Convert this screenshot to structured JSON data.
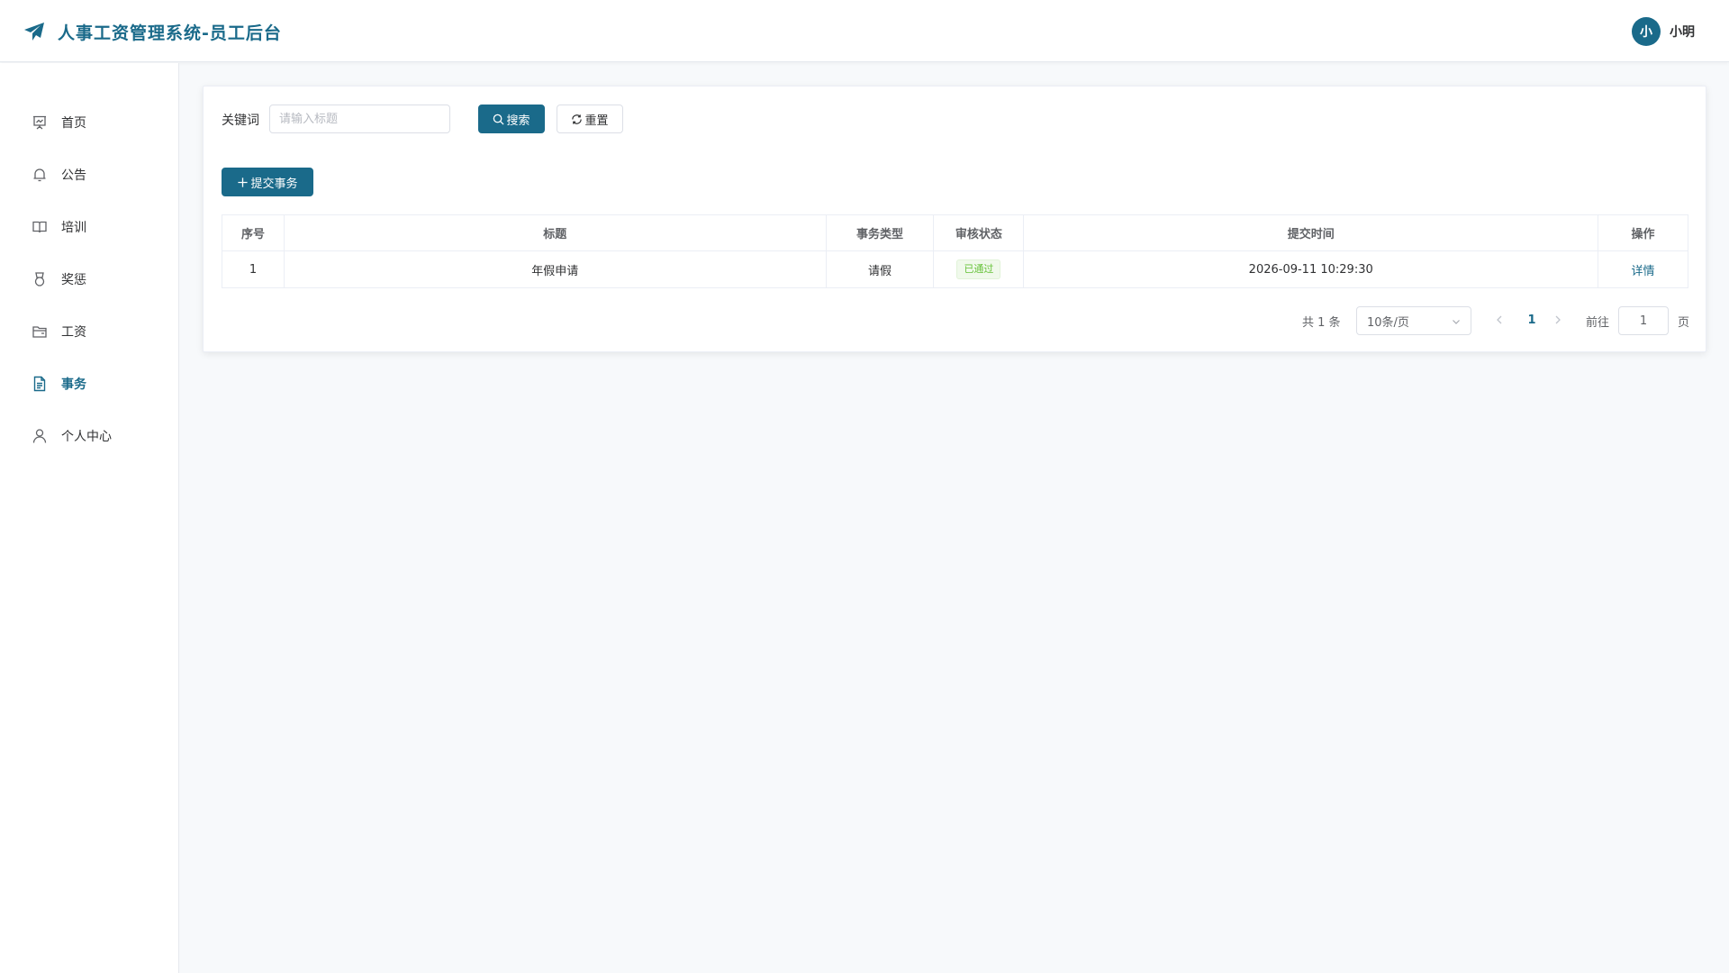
{
  "header": {
    "title": "人事工资管理系统-员工后台",
    "avatar_text": "小",
    "username": "小明"
  },
  "sidebar": {
    "items": [
      {
        "label": "首页",
        "icon": "presentation-chart-icon"
      },
      {
        "label": "公告",
        "icon": "bell-icon"
      },
      {
        "label": "培训",
        "icon": "book-icon"
      },
      {
        "label": "奖惩",
        "icon": "medal-icon"
      },
      {
        "label": "工资",
        "icon": "folder-icon"
      },
      {
        "label": "事务",
        "icon": "document-icon",
        "active": true
      },
      {
        "label": "个人中心",
        "icon": "user-icon"
      }
    ]
  },
  "search": {
    "label": "关键词",
    "placeholder": "请输入标题",
    "value": "",
    "search_button": "搜索",
    "reset_button": "重置"
  },
  "actions": {
    "submit_button": "提交事务"
  },
  "table": {
    "columns": [
      "序号",
      "标题",
      "事务类型",
      "审核状态",
      "提交时间",
      "操作"
    ],
    "rows": [
      {
        "index": "1",
        "title": "年假申请",
        "type": "请假",
        "status": "已通过",
        "time": "2026-09-11 10:29:30",
        "action": "详情"
      }
    ]
  },
  "pagination": {
    "total_text": "共 1 条",
    "page_size": "10条/页",
    "current_page": "1",
    "goto_label": "前往",
    "goto_value": "1",
    "goto_suffix": "页"
  },
  "colors": {
    "primary": "#1a6a8a",
    "success": "#67c23a",
    "background": "#f7f9fb"
  }
}
